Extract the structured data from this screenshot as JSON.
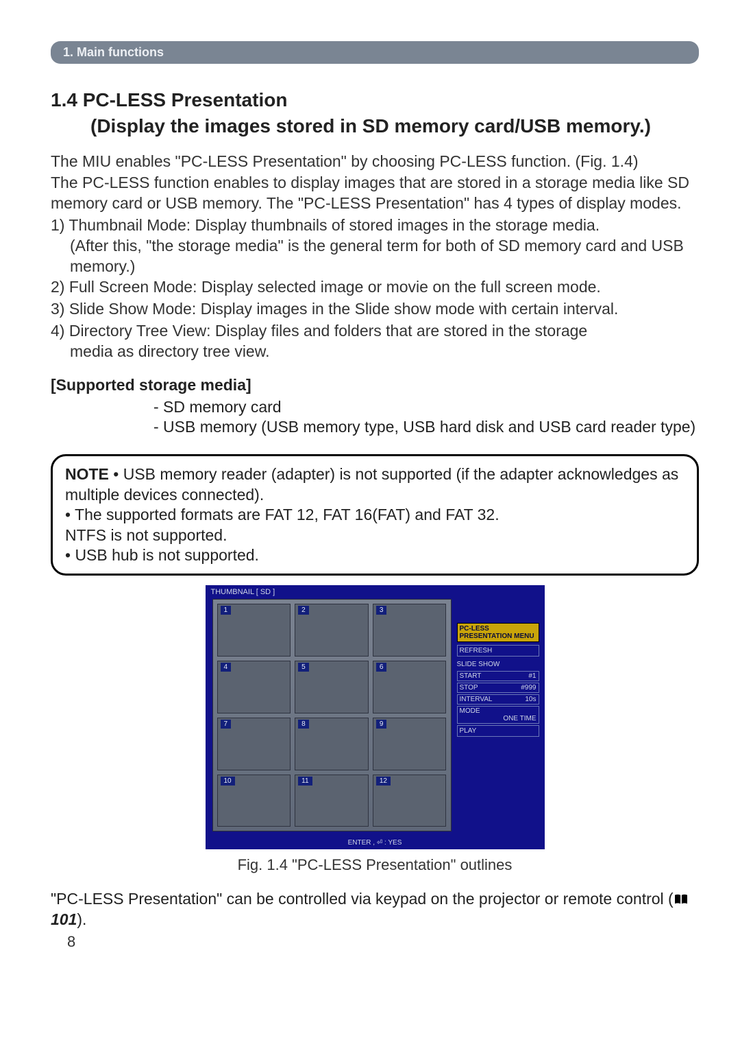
{
  "section_bar": "1. Main functions",
  "heading_main": "1.4 PC-LESS Presentation",
  "heading_sub": "(Display the images stored in SD memory card/USB memory.)",
  "intro_p1": "The MIU enables \"PC-LESS Presentation\" by choosing PC-LESS function. (Fig. 1.4)",
  "intro_p2": "The PC-LESS function enables to display images that are stored in a storage media like SD memory card or USB memory. The \"PC-LESS Presentation\" has 4 types of display modes.",
  "modes": {
    "m1a": "1) Thumbnail Mode: Display thumbnails of stored images in the storage media.",
    "m1b": "(After this, \"the storage media\" is the general term for both of SD memory card and USB memory.)",
    "m2": "2) Full Screen Mode: Display selected image or movie on the full screen mode.",
    "m3": "3) Slide Show Mode: Display images in the Slide show mode with certain interval.",
    "m4a": "4) Directory Tree View: Display files and folders that are stored in the storage",
    "m4b": "media as directory tree view."
  },
  "supported_head": "[Supported storage media]",
  "supported": {
    "s1": "- SD memory card",
    "s2": "- USB memory (USB memory type, USB hard disk and USB card reader type)"
  },
  "note": {
    "label": "NOTE",
    "l1": "  • USB memory reader (adapter) is not supported (if the adapter acknowledges as multiple devices connected).",
    "l2": "• The supported formats are FAT 12, FAT 16(FAT) and FAT 32.",
    "l3": "NTFS is not supported.",
    "l4": "• USB hub is not supported."
  },
  "fig": {
    "title": "THUMBNAIL   [ SD ]",
    "thumbs": [
      "1",
      "2",
      "3",
      "4",
      "5",
      "6",
      "7",
      "8",
      "9",
      "10",
      "11",
      "12"
    ],
    "panel": {
      "title": "PC-LESS PRESENTATION MENU",
      "refresh": "REFRESH",
      "section": "SLIDE SHOW",
      "start_l": "START",
      "start_v": "#1",
      "stop_l": "STOP",
      "stop_v": "#999",
      "interval_l": "INTERVAL",
      "interval_v": "10s",
      "mode_l": "MODE",
      "mode_v": "ONE TIME",
      "play": "PLAY"
    },
    "footer": "ENTER , ⏎ : YES",
    "caption": "Fig. 1.4 \"PC-LESS Presentation\" outlines"
  },
  "after_fig_a": "\"PC-LESS Presentation\" can be controlled via keypad on the projector or remote control (",
  "after_fig_ref": "101",
  "after_fig_b": ").",
  "page_number": "8"
}
